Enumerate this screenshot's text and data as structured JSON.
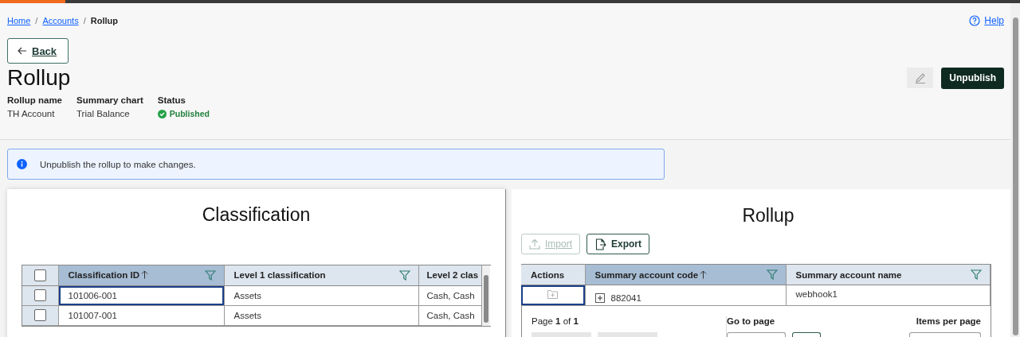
{
  "breadcrumbs": [
    {
      "label": "Home",
      "current": false
    },
    {
      "separator": "/",
      "label": "Accounts",
      "current": false
    },
    {
      "separator": "/",
      "label": "Rollup",
      "current": true
    }
  ],
  "help": "Help",
  "back_button": "Back",
  "title": "Rollup",
  "fields": [
    {
      "label": "Rollup name",
      "value": "TH Account",
      "kind": "text"
    },
    {
      "label": "Summary chart",
      "value": "Trial Balance",
      "kind": "text"
    },
    {
      "label": "Status",
      "value": "Published",
      "kind": "status"
    }
  ],
  "edit_button": {
    "disabled": true
  },
  "unpublish_button": "Unpublish",
  "notice": "Unpublish the rollup to make changes.",
  "classification": {
    "title": "Classification",
    "select_all": {
      "checked": false
    },
    "columns": [
      {
        "label": "Classification ID",
        "sorted": true,
        "filter": true
      },
      {
        "label": "Level 1 classification",
        "sorted": false,
        "filter": true
      },
      {
        "label": "Level 2 clas",
        "sorted": false
      }
    ],
    "rows": [
      {
        "checked": false,
        "cells": [
          {
            "text": "101006-001",
            "focused": true
          },
          {
            "text": "Assets",
            "focused": false
          },
          {
            "text": "Cash, Cash",
            "focused": false
          }
        ]
      },
      {
        "checked": false,
        "cells": [
          {
            "text": "101007-001",
            "focused": false
          },
          {
            "text": "Assets",
            "focused": false
          },
          {
            "text": "Cash, Cash",
            "focused": false
          }
        ]
      }
    ]
  },
  "rollup": {
    "title": "Rollup",
    "toolbar": [
      {
        "label": "Import",
        "kind": "import",
        "disabled": true
      },
      {
        "label": "Export",
        "kind": "export",
        "disabled": false
      }
    ],
    "columns": [
      {
        "label": "Actions",
        "sorted": false,
        "filter": false
      },
      {
        "label": "Summary account code",
        "sorted": true,
        "filter": true
      },
      {
        "label": "Summary account name",
        "sorted": false,
        "filter": true
      }
    ],
    "rows": [
      {
        "cells": [
          {
            "kind": "action",
            "focused": true
          },
          {
            "kind": "expandable",
            "text": "882041",
            "expanded": false,
            "focused": false
          },
          {
            "kind": "text",
            "text": "webhook1",
            "focused": false
          }
        ]
      }
    ],
    "pagination": {
      "page": "Page **1** of **1**",
      "go_to": "Go to page",
      "per_page": "Items per page"
    }
  }
}
